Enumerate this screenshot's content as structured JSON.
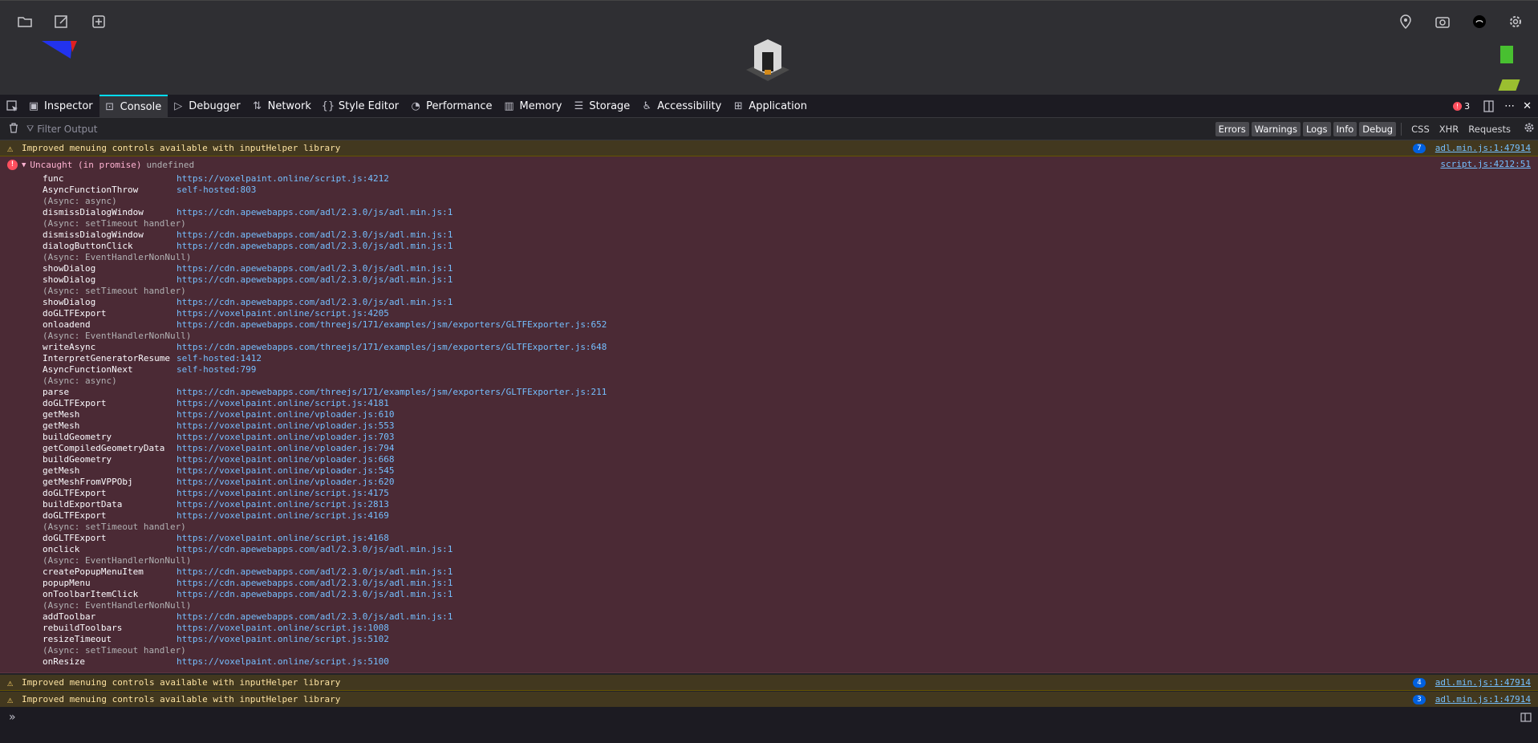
{
  "toolbar_tabs": [
    {
      "label": "Inspector",
      "icon": "inspector-icon"
    },
    {
      "label": "Console",
      "icon": "console-icon",
      "selected": true
    },
    {
      "label": "Debugger",
      "icon": "debugger-icon"
    },
    {
      "label": "Network",
      "icon": "network-icon"
    },
    {
      "label": "Style Editor",
      "icon": "style-editor-icon"
    },
    {
      "label": "Performance",
      "icon": "performance-icon"
    },
    {
      "label": "Memory",
      "icon": "memory-icon"
    },
    {
      "label": "Storage",
      "icon": "storage-icon"
    },
    {
      "label": "Accessibility",
      "icon": "accessibility-icon"
    },
    {
      "label": "Application",
      "icon": "application-icon"
    }
  ],
  "error_count": "3",
  "filter": {
    "placeholder": "Filter Output",
    "levels": [
      "Errors",
      "Warnings",
      "Logs",
      "Info",
      "Debug"
    ],
    "types": [
      "CSS",
      "XHR",
      "Requests"
    ]
  },
  "warnings": [
    {
      "text": "Improved menuing controls available with inputHelper library",
      "count": "7",
      "source": "adl.min.js:1:47914"
    },
    {
      "text": "Improved menuing controls available with inputHelper library",
      "count": "4",
      "source": "adl.min.js:1:47914"
    },
    {
      "text": "Improved menuing controls available with inputHelper library",
      "count": "3",
      "source": "adl.min.js:1:47914"
    }
  ],
  "error": {
    "message": "Uncaught (in promise)",
    "detail": "undefined",
    "source": "script.js:4212:51",
    "frames": [
      {
        "fn": "func",
        "loc": "https://voxelpaint.online/script.js:4212"
      },
      {
        "fn": "AsyncFunctionThrow",
        "loc": "self-hosted:803"
      },
      {
        "async": "(Async: async)"
      },
      {
        "fn": "dismissDialogWindow",
        "loc": "https://cdn.apewebapps.com/adl/2.3.0/js/adl.min.js:1"
      },
      {
        "async": "(Async: setTimeout handler)"
      },
      {
        "fn": "dismissDialogWindow",
        "loc": "https://cdn.apewebapps.com/adl/2.3.0/js/adl.min.js:1"
      },
      {
        "fn": "dialogButtonClick",
        "loc": "https://cdn.apewebapps.com/adl/2.3.0/js/adl.min.js:1"
      },
      {
        "async": "(Async: EventHandlerNonNull)"
      },
      {
        "fn": "showDialog",
        "loc": "https://cdn.apewebapps.com/adl/2.3.0/js/adl.min.js:1"
      },
      {
        "fn": "showDialog",
        "loc": "https://cdn.apewebapps.com/adl/2.3.0/js/adl.min.js:1"
      },
      {
        "async": "(Async: setTimeout handler)"
      },
      {
        "fn": "showDialog",
        "loc": "https://cdn.apewebapps.com/adl/2.3.0/js/adl.min.js:1"
      },
      {
        "fn": "doGLTFExport",
        "loc": "https://voxelpaint.online/script.js:4205"
      },
      {
        "fn": "onloadend",
        "loc": "https://cdn.apewebapps.com/threejs/171/examples/jsm/exporters/GLTFExporter.js:652"
      },
      {
        "async": "(Async: EventHandlerNonNull)"
      },
      {
        "fn": "writeAsync",
        "loc": "https://cdn.apewebapps.com/threejs/171/examples/jsm/exporters/GLTFExporter.js:648"
      },
      {
        "fn": "InterpretGeneratorResume",
        "loc": "self-hosted:1412"
      },
      {
        "fn": "AsyncFunctionNext",
        "loc": "self-hosted:799"
      },
      {
        "async": "(Async: async)"
      },
      {
        "fn": "parse",
        "loc": "https://cdn.apewebapps.com/threejs/171/examples/jsm/exporters/GLTFExporter.js:211"
      },
      {
        "fn": "doGLTFExport",
        "loc": "https://voxelpaint.online/script.js:4181"
      },
      {
        "fn": "getMesh",
        "loc": "https://voxelpaint.online/vploader.js:610"
      },
      {
        "fn": "getMesh",
        "loc": "https://voxelpaint.online/vploader.js:553"
      },
      {
        "fn": "buildGeometry",
        "loc": "https://voxelpaint.online/vploader.js:703"
      },
      {
        "fn": "getCompiledGeometryData",
        "loc": "https://voxelpaint.online/vploader.js:794"
      },
      {
        "fn": "buildGeometry",
        "loc": "https://voxelpaint.online/vploader.js:668"
      },
      {
        "fn": "getMesh",
        "loc": "https://voxelpaint.online/vploader.js:545"
      },
      {
        "fn": "getMeshFromVPPObj",
        "loc": "https://voxelpaint.online/vploader.js:620"
      },
      {
        "fn": "doGLTFExport",
        "loc": "https://voxelpaint.online/script.js:4175"
      },
      {
        "fn": "buildExportData",
        "loc": "https://voxelpaint.online/script.js:2813"
      },
      {
        "fn": "doGLTFExport",
        "loc": "https://voxelpaint.online/script.js:4169"
      },
      {
        "async": "(Async: setTimeout handler)"
      },
      {
        "fn": "doGLTFExport",
        "loc": "https://voxelpaint.online/script.js:4168"
      },
      {
        "fn": "onclick",
        "loc": "https://cdn.apewebapps.com/adl/2.3.0/js/adl.min.js:1"
      },
      {
        "async": "(Async: EventHandlerNonNull)"
      },
      {
        "fn": "createPopupMenuItem",
        "loc": "https://cdn.apewebapps.com/adl/2.3.0/js/adl.min.js:1"
      },
      {
        "fn": "popupMenu",
        "loc": "https://cdn.apewebapps.com/adl/2.3.0/js/adl.min.js:1"
      },
      {
        "fn": "onToolbarItemClick",
        "loc": "https://cdn.apewebapps.com/adl/2.3.0/js/adl.min.js:1"
      },
      {
        "async": "(Async: EventHandlerNonNull)"
      },
      {
        "fn": "addToolbar",
        "loc": "https://cdn.apewebapps.com/adl/2.3.0/js/adl.min.js:1"
      },
      {
        "fn": "rebuildToolbars",
        "loc": "https://voxelpaint.online/script.js:1008"
      },
      {
        "fn": "resizeTimeout",
        "loc": "https://voxelpaint.online/script.js:5102"
      },
      {
        "async": "(Async: setTimeout handler)"
      },
      {
        "fn": "onResize",
        "loc": "https://voxelpaint.online/script.js:5100"
      }
    ]
  },
  "colors": {
    "accent": "#00ddff",
    "link": "#75bfff",
    "error_bg": "#4b2a35",
    "warn_bg": "#42381f"
  }
}
